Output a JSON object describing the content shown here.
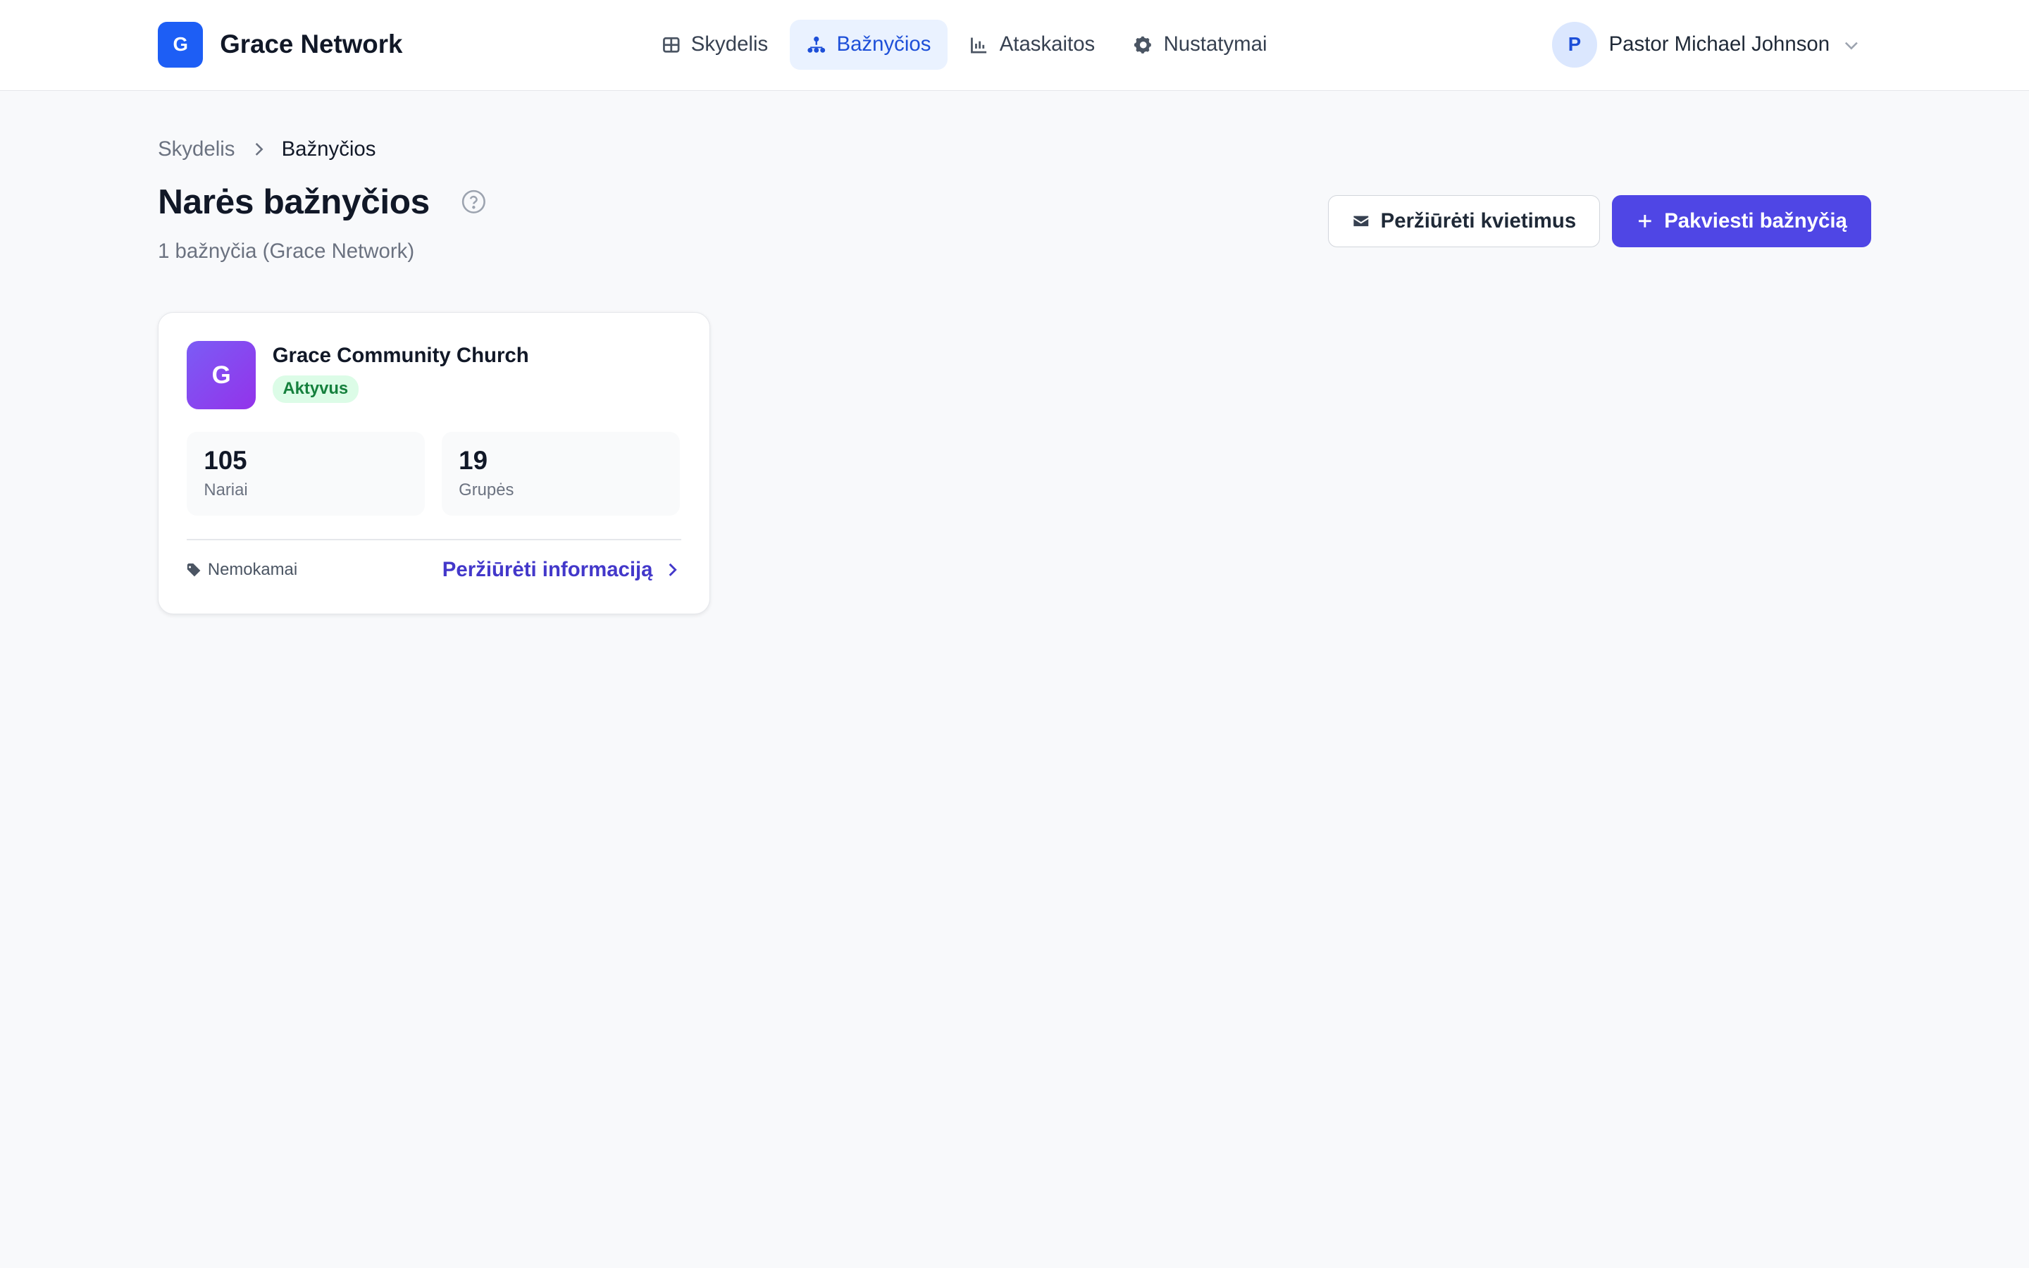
{
  "brand": {
    "logo_letter": "G",
    "name": "Grace Network",
    "color": "#1d5ef5"
  },
  "nav": {
    "items": [
      {
        "label": "Skydelis",
        "icon": "grid-icon",
        "active": false
      },
      {
        "label": "Bažnyčios",
        "icon": "network-icon",
        "active": true
      },
      {
        "label": "Ataskaitos",
        "icon": "chart-icon",
        "active": false
      },
      {
        "label": "Nustatymai",
        "icon": "gear-icon",
        "active": false
      }
    ]
  },
  "user": {
    "avatar_letter": "P",
    "name": "Pastor Michael Johnson"
  },
  "breadcrumb": {
    "parent": "Skydelis",
    "current": "Bažnyčios"
  },
  "page": {
    "title": "Narės bažnyčios",
    "subtitle": "1 bažnyčia (Grace Network)"
  },
  "actions": {
    "view_invites_label": "Peržiūrėti kvietimus",
    "invite_church_label": "Pakviesti bažnyčią",
    "primary_color": "#4f46e5"
  },
  "church_card": {
    "logo_letter": "G",
    "name": "Grace Community Church",
    "status": "Aktyvus",
    "stats": [
      {
        "value": "105",
        "label": "Nariai"
      },
      {
        "value": "19",
        "label": "Grupės"
      }
    ],
    "plan": "Nemokamai",
    "detail_link": "Peržiūrėti informaciją"
  }
}
